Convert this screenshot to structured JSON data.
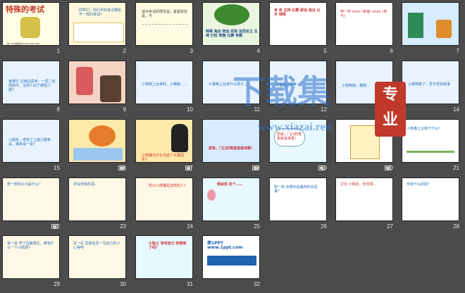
{
  "watermark": {
    "main": "下载集",
    "url": "www.xiazai.red",
    "stamp_line1": "专",
    "stamp_line2": "业"
  },
  "slides": [
    {
      "num": "1",
      "text": "特殊的考试",
      "sub": "第一PPT模板网-WWW.1PPT.COM"
    },
    {
      "num": "2",
      "text": "同学们，你们平时考过哪些不一样的考试？"
    },
    {
      "num": "3",
      "text": "谈对考试的感觉是，紧紧张张是，不"
    },
    {
      "num": "4",
      "text": "特殊 淘汰 统治 实际 总而言之 主持 打扮 秀丽 比赛 考题"
    },
    {
      "num": "5",
      "text": "考 考 主持 比赛 统治 淘汰 以外 特殊"
    },
    {
      "num": "6",
      "text": "辨一辨 shèn (参差) shēn (参与)"
    },
    {
      "num": "7",
      "text": ""
    },
    {
      "num": "8",
      "text": "读课文 边读边思考：一至二自然段中，主持人出了哪些小题？"
    },
    {
      "num": "9",
      "text": ""
    },
    {
      "num": "10",
      "text": "小狗熊上台考时，小猴跳……"
    },
    {
      "num": "11",
      "text": "小猴跳上台考什么样子…"
    },
    {
      "num": "12",
      "text": "小猫熊台考？"
    },
    {
      "num": "13",
      "text": "小狗熊跳，猫熊…"
    },
    {
      "num": "14",
      "text": "小猴熊跳了，爱不爱的故事"
    },
    {
      "num": "15",
      "text": "小朋友，考完了上面小题考试，谁来说一说？"
    },
    {
      "num": "16",
      "text": ""
    },
    {
      "num": "17",
      "text": "小熊猫为什么当选了大赛冠军？"
    },
    {
      "num": "18",
      "text": ""
    },
    {
      "num": "19",
      "text": "原来，门口的果皮就是考题！"
    },
    {
      "num": "20",
      "text": "原来，门口的果皮就是考题！"
    },
    {
      "num": "21",
      "text": "小熊猫上台做了什么？"
    },
    {
      "num": "22",
      "text": "想一想你以为是什么？"
    },
    {
      "num": "23",
      "text": "评议自我反思。"
    },
    {
      "num": "24",
      "text": "所以小熊猫是怎样的人？"
    },
    {
      "num": "25",
      "text": "我会找 这个……"
    },
    {
      "num": "26",
      "text": "想一想 如果你是裁判你会选谁？"
    },
    {
      "num": "27",
      "text": "讨论 小朋友，你觉得…"
    },
    {
      "num": "28",
      "text": "你有什么收获？"
    },
    {
      "num": "29",
      "text": "说一说 学了这篇课文，谁有什么一个小收获？"
    },
    {
      "num": "30",
      "text": "写一写 回家后写一写自己的小心得吧"
    },
    {
      "num": "31",
      "text": "小贴士 夸夸自己 你做到了吗？"
    },
    {
      "num": "32",
      "text": "第1PPT www.1ppt.com"
    }
  ]
}
